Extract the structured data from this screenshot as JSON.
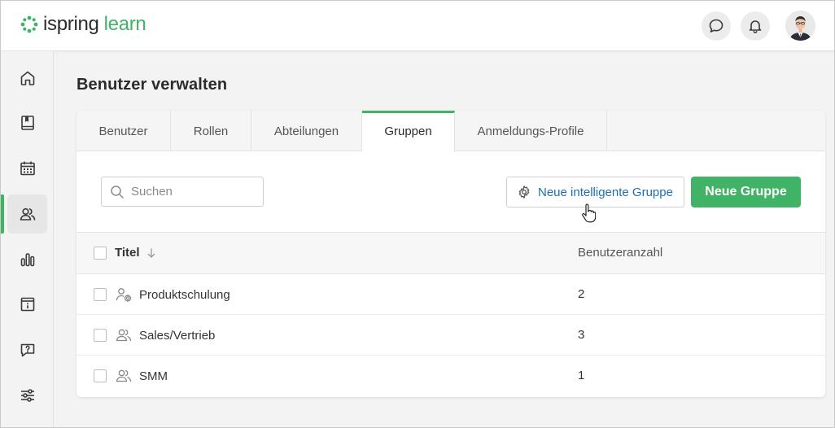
{
  "header": {
    "logo_main": "ispring",
    "logo_accent": "learn",
    "chat_icon": "chat-bubble-icon",
    "bell_icon": "bell-icon",
    "brand_color": "#41b366"
  },
  "sidebar": {
    "items": [
      {
        "name": "home",
        "icon": "home-icon"
      },
      {
        "name": "catalog",
        "icon": "book-icon"
      },
      {
        "name": "calendar",
        "icon": "calendar-icon"
      },
      {
        "name": "users",
        "icon": "users-icon",
        "active": true
      },
      {
        "name": "reports",
        "icon": "bar-chart-icon"
      },
      {
        "name": "info",
        "icon": "info-archive-icon"
      },
      {
        "name": "help",
        "icon": "question-bubble-icon"
      },
      {
        "name": "settings",
        "icon": "sliders-icon"
      }
    ]
  },
  "page": {
    "title": "Benutzer verwalten"
  },
  "tabs": [
    {
      "label": "Benutzer",
      "active": false
    },
    {
      "label": "Rollen",
      "active": false
    },
    {
      "label": "Abteilungen",
      "active": false
    },
    {
      "label": "Gruppen",
      "active": true
    },
    {
      "label": "Anmeldungs-Profile",
      "active": false
    }
  ],
  "toolbar": {
    "search_placeholder": "Suchen",
    "search_value": "",
    "smart_group_label": "Neue intelligente Gruppe",
    "new_group_label": "Neue Gruppe"
  },
  "table": {
    "columns": {
      "title": "Titel",
      "count": "Benutzeranzahl"
    },
    "rows": [
      {
        "title": "Produktschulung",
        "count": "2",
        "icon": "smart-group-icon"
      },
      {
        "title": "Sales/Vertrieb",
        "count": "3",
        "icon": "group-icon"
      },
      {
        "title": "SMM",
        "count": "1",
        "icon": "group-icon"
      }
    ]
  }
}
